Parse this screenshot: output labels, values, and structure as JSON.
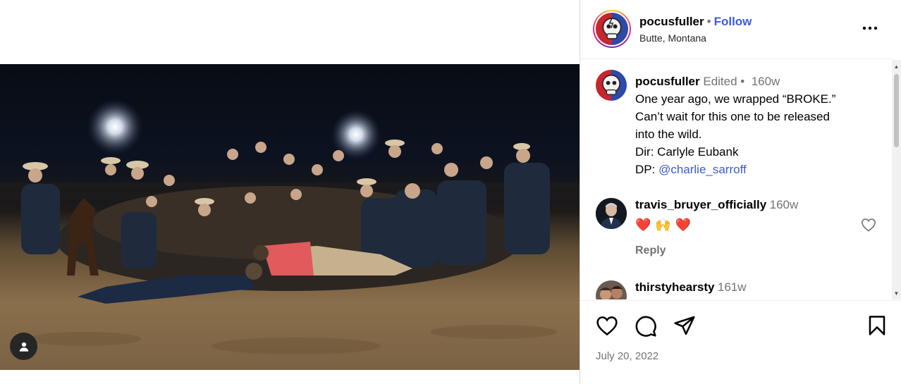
{
  "post": {
    "username": "pocusfuller",
    "follow_label": "Follow",
    "location": "Butte, Montana",
    "date": "July 20, 2022"
  },
  "caption": {
    "username": "pocusfuller",
    "edited": "Edited",
    "age": "160w",
    "lines": [
      "One year ago, we wrapped “BROKE.”",
      "Can’t wait for this one to be released",
      "into the wild.",
      "Dir: Carlyle Eubank"
    ],
    "dp_prefix": "DP: ",
    "dp_mention": "@charlie_sarroff"
  },
  "comments": [
    {
      "username": "travis_bruyer_officially",
      "age": "160w",
      "text": "❤️🙌❤️",
      "reply_label": "Reply"
    },
    {
      "username": "thirstyhearsty",
      "age": "161w"
    }
  ],
  "icons": {
    "more": "more-options-icon",
    "heart": "heart-icon",
    "comment": "comment-icon",
    "share": "share-icon",
    "save": "bookmark-icon",
    "tag": "user-tag-icon"
  },
  "colors": {
    "follow": "#3b5bdb",
    "secondary_text": "#737373",
    "heart_emoji": "#e0245e"
  }
}
